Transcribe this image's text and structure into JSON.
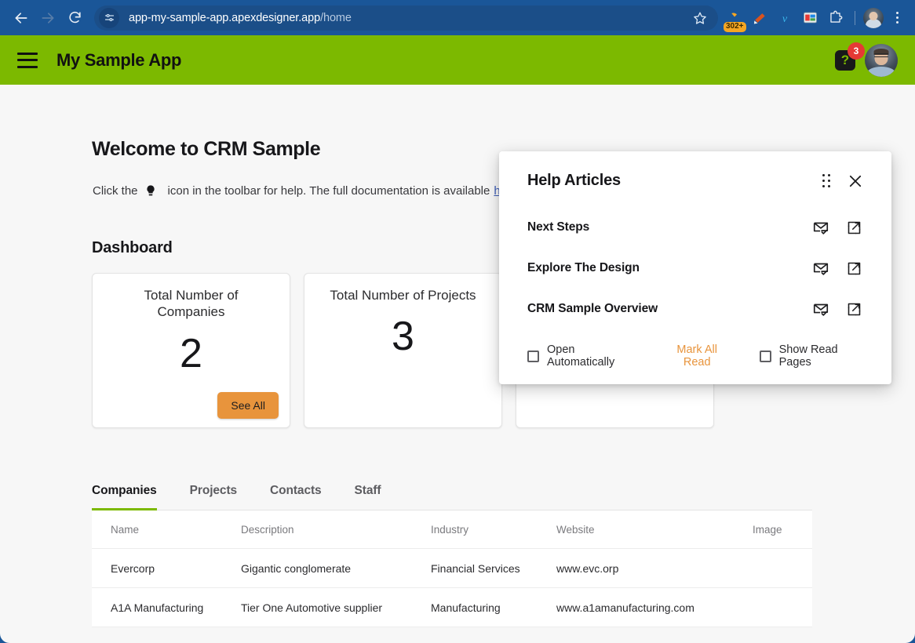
{
  "browser": {
    "back_icon": "arrow-left-icon",
    "forward_icon": "arrow-right-icon",
    "reload_icon": "reload-icon",
    "site_info_icon": "site-settings-icon",
    "url_host": "app-my-sample-app.apexdesigner.app",
    "url_path": "/home",
    "bookmark_icon": "star-icon",
    "extensions": [
      {
        "name": "extension-badge-302",
        "badge": "302+"
      },
      {
        "name": "extension-pencil-icon"
      },
      {
        "name": "extension-vimeo-icon"
      },
      {
        "name": "extension-media-icon"
      },
      {
        "name": "extensions-puzzle-icon"
      }
    ],
    "profile_name": "profile-avatar",
    "menu_icon": "three-dot-menu-icon"
  },
  "app_header": {
    "menu_icon": "hamburger-menu-icon",
    "title": "My Sample App",
    "help_glyph": "?",
    "help_badge_count": "3",
    "avatar": "user-avatar"
  },
  "page": {
    "welcome_title": "Welcome to CRM Sample",
    "welcome_prefix": "Click the",
    "welcome_middle": "icon in the toolbar for help. The full documentation is available",
    "welcome_link": "h",
    "bulb_icon": "lightbulb-icon",
    "dashboard_title": "Dashboard"
  },
  "cards": [
    {
      "title": "Total Number of Companies",
      "value": "2",
      "button": "See All"
    },
    {
      "title": "Total Number of Projects",
      "value": "3",
      "button": ""
    },
    {
      "title": "",
      "value": "",
      "button": ""
    }
  ],
  "tabs": [
    {
      "label": "Companies",
      "active": true
    },
    {
      "label": "Projects",
      "active": false
    },
    {
      "label": "Contacts",
      "active": false
    },
    {
      "label": "Staff",
      "active": false
    }
  ],
  "table": {
    "columns": [
      "Name",
      "Description",
      "Industry",
      "Website",
      "Image"
    ],
    "rows": [
      {
        "name": "Evercorp",
        "description": "Gigantic conglomerate",
        "industry": "Financial Services",
        "website": "www.evc.orp",
        "image": ""
      },
      {
        "name": "A1A Manufacturing",
        "description": "Tier One Automotive supplier",
        "industry": "Manufacturing",
        "website": "www.a1amanufacturing.com",
        "image": ""
      }
    ]
  },
  "dialog": {
    "title": "Help Articles",
    "drag_icon": "drag-handle-icon",
    "close_icon": "close-icon",
    "articles": [
      {
        "title": "Next Steps",
        "mark_read_icon": "mark-email-read-icon",
        "open_icon": "open-in-new-icon"
      },
      {
        "title": "Explore The Design",
        "mark_read_icon": "mark-email-read-icon",
        "open_icon": "open-in-new-icon"
      },
      {
        "title": "CRM Sample Overview",
        "mark_read_icon": "mark-email-read-icon",
        "open_icon": "open-in-new-icon"
      }
    ],
    "open_automatically_label": "Open Automatically",
    "open_automatically_checked": false,
    "mark_all_read_label": "Mark All Read",
    "show_read_pages_label": "Show Read Pages",
    "show_read_pages_checked": false
  },
  "colors": {
    "brand_green": "#7cb900",
    "accent_orange": "#e8943c",
    "browser_blue": "#1a5698",
    "badge_red": "#e53935",
    "link_blue": "#3b5bb5"
  }
}
